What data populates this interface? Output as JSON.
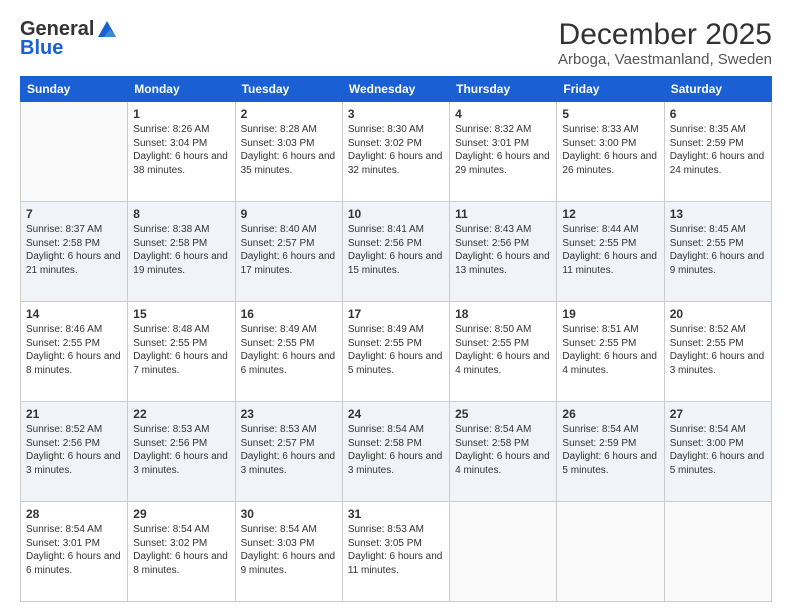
{
  "logo": {
    "general": "General",
    "blue": "Blue"
  },
  "title": "December 2025",
  "subtitle": "Arboga, Vaestmanland, Sweden",
  "days": [
    "Sunday",
    "Monday",
    "Tuesday",
    "Wednesday",
    "Thursday",
    "Friday",
    "Saturday"
  ],
  "weeks": [
    [
      {
        "day": "",
        "sunrise": "",
        "sunset": "",
        "daylight": ""
      },
      {
        "day": "1",
        "sunrise": "Sunrise: 8:26 AM",
        "sunset": "Sunset: 3:04 PM",
        "daylight": "Daylight: 6 hours and 38 minutes."
      },
      {
        "day": "2",
        "sunrise": "Sunrise: 8:28 AM",
        "sunset": "Sunset: 3:03 PM",
        "daylight": "Daylight: 6 hours and 35 minutes."
      },
      {
        "day": "3",
        "sunrise": "Sunrise: 8:30 AM",
        "sunset": "Sunset: 3:02 PM",
        "daylight": "Daylight: 6 hours and 32 minutes."
      },
      {
        "day": "4",
        "sunrise": "Sunrise: 8:32 AM",
        "sunset": "Sunset: 3:01 PM",
        "daylight": "Daylight: 6 hours and 29 minutes."
      },
      {
        "day": "5",
        "sunrise": "Sunrise: 8:33 AM",
        "sunset": "Sunset: 3:00 PM",
        "daylight": "Daylight: 6 hours and 26 minutes."
      },
      {
        "day": "6",
        "sunrise": "Sunrise: 8:35 AM",
        "sunset": "Sunset: 2:59 PM",
        "daylight": "Daylight: 6 hours and 24 minutes."
      }
    ],
    [
      {
        "day": "7",
        "sunrise": "Sunrise: 8:37 AM",
        "sunset": "Sunset: 2:58 PM",
        "daylight": "Daylight: 6 hours and 21 minutes."
      },
      {
        "day": "8",
        "sunrise": "Sunrise: 8:38 AM",
        "sunset": "Sunset: 2:58 PM",
        "daylight": "Daylight: 6 hours and 19 minutes."
      },
      {
        "day": "9",
        "sunrise": "Sunrise: 8:40 AM",
        "sunset": "Sunset: 2:57 PM",
        "daylight": "Daylight: 6 hours and 17 minutes."
      },
      {
        "day": "10",
        "sunrise": "Sunrise: 8:41 AM",
        "sunset": "Sunset: 2:56 PM",
        "daylight": "Daylight: 6 hours and 15 minutes."
      },
      {
        "day": "11",
        "sunrise": "Sunrise: 8:43 AM",
        "sunset": "Sunset: 2:56 PM",
        "daylight": "Daylight: 6 hours and 13 minutes."
      },
      {
        "day": "12",
        "sunrise": "Sunrise: 8:44 AM",
        "sunset": "Sunset: 2:55 PM",
        "daylight": "Daylight: 6 hours and 11 minutes."
      },
      {
        "day": "13",
        "sunrise": "Sunrise: 8:45 AM",
        "sunset": "Sunset: 2:55 PM",
        "daylight": "Daylight: 6 hours and 9 minutes."
      }
    ],
    [
      {
        "day": "14",
        "sunrise": "Sunrise: 8:46 AM",
        "sunset": "Sunset: 2:55 PM",
        "daylight": "Daylight: 6 hours and 8 minutes."
      },
      {
        "day": "15",
        "sunrise": "Sunrise: 8:48 AM",
        "sunset": "Sunset: 2:55 PM",
        "daylight": "Daylight: 6 hours and 7 minutes."
      },
      {
        "day": "16",
        "sunrise": "Sunrise: 8:49 AM",
        "sunset": "Sunset: 2:55 PM",
        "daylight": "Daylight: 6 hours and 6 minutes."
      },
      {
        "day": "17",
        "sunrise": "Sunrise: 8:49 AM",
        "sunset": "Sunset: 2:55 PM",
        "daylight": "Daylight: 6 hours and 5 minutes."
      },
      {
        "day": "18",
        "sunrise": "Sunrise: 8:50 AM",
        "sunset": "Sunset: 2:55 PM",
        "daylight": "Daylight: 6 hours and 4 minutes."
      },
      {
        "day": "19",
        "sunrise": "Sunrise: 8:51 AM",
        "sunset": "Sunset: 2:55 PM",
        "daylight": "Daylight: 6 hours and 4 minutes."
      },
      {
        "day": "20",
        "sunrise": "Sunrise: 8:52 AM",
        "sunset": "Sunset: 2:55 PM",
        "daylight": "Daylight: 6 hours and 3 minutes."
      }
    ],
    [
      {
        "day": "21",
        "sunrise": "Sunrise: 8:52 AM",
        "sunset": "Sunset: 2:56 PM",
        "daylight": "Daylight: 6 hours and 3 minutes."
      },
      {
        "day": "22",
        "sunrise": "Sunrise: 8:53 AM",
        "sunset": "Sunset: 2:56 PM",
        "daylight": "Daylight: 6 hours and 3 minutes."
      },
      {
        "day": "23",
        "sunrise": "Sunrise: 8:53 AM",
        "sunset": "Sunset: 2:57 PM",
        "daylight": "Daylight: 6 hours and 3 minutes."
      },
      {
        "day": "24",
        "sunrise": "Sunrise: 8:54 AM",
        "sunset": "Sunset: 2:58 PM",
        "daylight": "Daylight: 6 hours and 3 minutes."
      },
      {
        "day": "25",
        "sunrise": "Sunrise: 8:54 AM",
        "sunset": "Sunset: 2:58 PM",
        "daylight": "Daylight: 6 hours and 4 minutes."
      },
      {
        "day": "26",
        "sunrise": "Sunrise: 8:54 AM",
        "sunset": "Sunset: 2:59 PM",
        "daylight": "Daylight: 6 hours and 5 minutes."
      },
      {
        "day": "27",
        "sunrise": "Sunrise: 8:54 AM",
        "sunset": "Sunset: 3:00 PM",
        "daylight": "Daylight: 6 hours and 5 minutes."
      }
    ],
    [
      {
        "day": "28",
        "sunrise": "Sunrise: 8:54 AM",
        "sunset": "Sunset: 3:01 PM",
        "daylight": "Daylight: 6 hours and 6 minutes."
      },
      {
        "day": "29",
        "sunrise": "Sunrise: 8:54 AM",
        "sunset": "Sunset: 3:02 PM",
        "daylight": "Daylight: 6 hours and 8 minutes."
      },
      {
        "day": "30",
        "sunrise": "Sunrise: 8:54 AM",
        "sunset": "Sunset: 3:03 PM",
        "daylight": "Daylight: 6 hours and 9 minutes."
      },
      {
        "day": "31",
        "sunrise": "Sunrise: 8:53 AM",
        "sunset": "Sunset: 3:05 PM",
        "daylight": "Daylight: 6 hours and 11 minutes."
      },
      {
        "day": "",
        "sunrise": "",
        "sunset": "",
        "daylight": ""
      },
      {
        "day": "",
        "sunrise": "",
        "sunset": "",
        "daylight": ""
      },
      {
        "day": "",
        "sunrise": "",
        "sunset": "",
        "daylight": ""
      }
    ]
  ],
  "row_shades": [
    false,
    true,
    false,
    true,
    false
  ]
}
